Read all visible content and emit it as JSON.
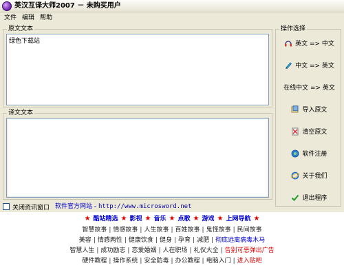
{
  "title": "英汉互译大师2007 － 未购买用户",
  "menu": [
    "文件",
    "编辑",
    "帮助"
  ],
  "source_group_label": "原文文本",
  "source_text": "绿色下载站",
  "result_group_label": "译文文本",
  "result_text": "",
  "ops_group_label": "操作选择",
  "ops": [
    {
      "label": "英文 => 中文",
      "icon": "headphones-icon"
    },
    {
      "label": "中文 => 英文",
      "icon": "pen-icon"
    },
    {
      "label": "在线中文 => 英文",
      "icon": ""
    },
    {
      "label": "导入原文",
      "icon": "import-icon"
    },
    {
      "label": "清空原文",
      "icon": "clear-icon"
    },
    {
      "label": "软件注册",
      "icon": "register-icon"
    },
    {
      "label": "关于我们",
      "icon": "ie-icon"
    },
    {
      "label": "退出程序",
      "icon": "exit-icon"
    }
  ],
  "close_info_label": "关闭资讯窗口",
  "website_label": "软件官方网站 - ",
  "website_url": "http://www.microsword.net",
  "nav": [
    "酷站精选",
    "影视",
    "音乐",
    "点歌",
    "游戏",
    "上网导航"
  ],
  "link_rows": [
    [
      "智慧故事",
      "情感故事",
      "人生故事",
      "百姓故事",
      "鬼怪故事",
      "民间故事"
    ],
    [
      "美容",
      "情感两性",
      "健康饮食",
      "健身",
      "孕育",
      "减肥",
      "彻底远离病毒木马"
    ],
    [
      "智慧人生",
      "成功励志",
      "恋爱婚姻",
      "人在职场",
      "礼仪大全",
      "告别可恶弹出广告"
    ],
    [
      "硬件教程",
      "操作系统",
      "安全防毒",
      "办公教程",
      "电脑入门",
      "进入贴吧"
    ]
  ],
  "colors": {
    "accent_blue": "#0000cc",
    "accent_red": "#e00000",
    "window": "#ece9d8"
  }
}
